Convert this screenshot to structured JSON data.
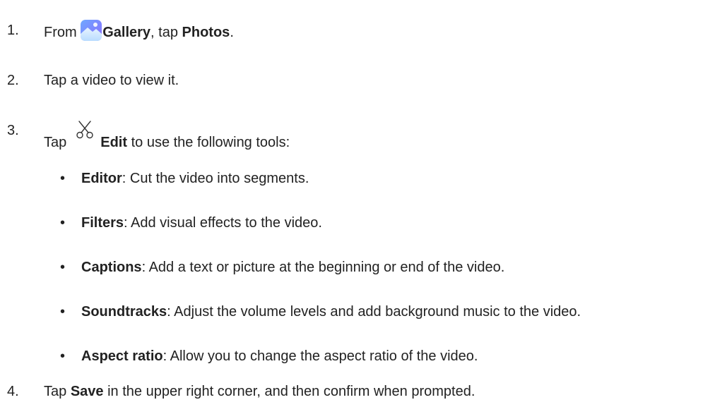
{
  "steps": [
    {
      "number": "1.",
      "pre": "From ",
      "app": "Gallery",
      "mid": ", tap ",
      "target": "Photos",
      "post": "."
    },
    {
      "number": "2.",
      "text": "Tap a video to view it."
    },
    {
      "number": "3.",
      "pre": "Tap",
      "action": "Edit",
      "post": " to use the following tools:"
    },
    {
      "number": "4.",
      "pre": "Tap ",
      "action": "Save",
      "post": " in the upper right corner, and then confirm when prompted."
    }
  ],
  "tools": [
    {
      "bullet": "•",
      "name": "Editor",
      "desc": ": Cut the video into segments."
    },
    {
      "bullet": "•",
      "name": "Filters",
      "desc": ": Add visual effects to the video."
    },
    {
      "bullet": "•",
      "name": "Captions",
      "desc": ": Add a text or picture at the beginning or end of the video."
    },
    {
      "bullet": "•",
      "name": "Soundtracks",
      "desc": ": Adjust the volume levels and add background music to the video."
    },
    {
      "bullet": "•",
      "name": "Aspect ratio",
      "desc": ": Allow you to change the aspect ratio of the video."
    }
  ],
  "icons": {
    "gallery": "gallery-app-icon",
    "edit": "scissors-icon"
  }
}
